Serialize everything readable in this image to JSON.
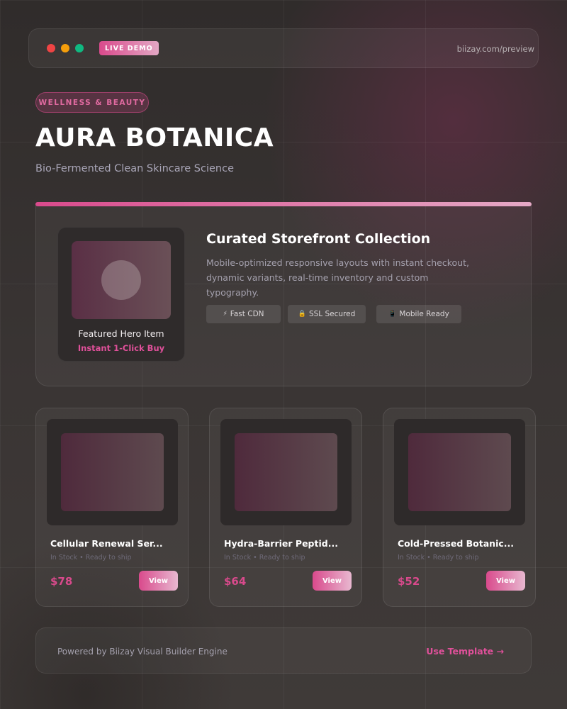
{
  "browser": {
    "badge": "LIVE DEMO",
    "url": "biizay.com/preview"
  },
  "hero": {
    "category": "WELLNESS & BEAUTY",
    "title": "AURA BOTANICA",
    "subtitle": "Bio-Fermented Clean Skincare Science"
  },
  "featured": {
    "item_name": "Featured Hero Item",
    "item_cta": "Instant 1-Click Buy",
    "title": "Curated Storefront Collection",
    "description": "Mobile-optimized responsive layouts with instant checkout, dynamic variants, real-time inventory and custom typography.",
    "chips": [
      {
        "icon": "lightning-icon",
        "glyph": "⚡",
        "label": "Fast CDN"
      },
      {
        "icon": "lock-icon",
        "glyph": "🔒",
        "label": "SSL Secured"
      },
      {
        "icon": "mobile-icon",
        "glyph": "📱",
        "label": "Mobile Ready"
      }
    ]
  },
  "products": [
    {
      "name": "Cellular Renewal Ser...",
      "status": "In Stock • Ready to ship",
      "price": "$78",
      "button": "View"
    },
    {
      "name": "Hydra-Barrier Peptid...",
      "status": "In Stock • Ready to ship",
      "price": "$64",
      "button": "View"
    },
    {
      "name": "Cold-Pressed Botanic...",
      "status": "In Stock • Ready to ship",
      "price": "$52",
      "button": "View"
    }
  ],
  "footer": {
    "text": "Powered by Biizay Visual Builder Engine",
    "link": "Use Template →"
  },
  "colors": {
    "accent": "#d94a8c",
    "accent_light": "#e5a9c6",
    "background": "#322f2e"
  }
}
